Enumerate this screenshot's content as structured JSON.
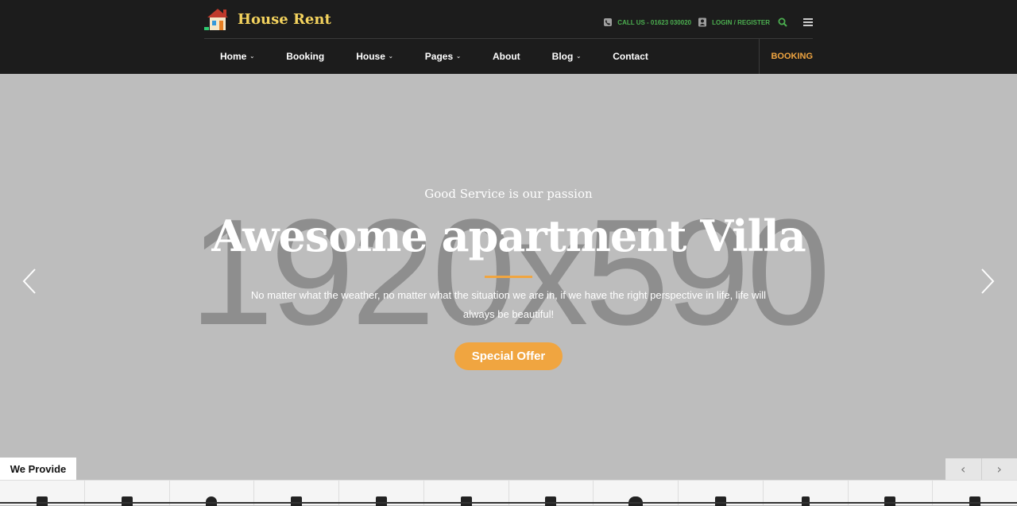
{
  "brand": {
    "name": "House Rent"
  },
  "topbar": {
    "call_label": "CALL US - 01623 030020",
    "login_label": "LOGIN / REGISTER"
  },
  "nav": {
    "items": [
      {
        "label": "Home",
        "has_dropdown": true
      },
      {
        "label": "Booking",
        "has_dropdown": false
      },
      {
        "label": "House",
        "has_dropdown": true
      },
      {
        "label": "Pages",
        "has_dropdown": true
      },
      {
        "label": "About",
        "has_dropdown": false
      },
      {
        "label": "Blog",
        "has_dropdown": true
      },
      {
        "label": "Contact",
        "has_dropdown": false
      }
    ],
    "booking_label": "BOOKING",
    "caret": "⌄"
  },
  "hero": {
    "placeholder": "1920x590",
    "kicker": "Good Service is our passion",
    "title": "Awesome apartment Villa",
    "description": "No matter what the weather, no matter what the situation we are in, if we have the right perspective in life, life will always be beautiful!",
    "cta_label": "Special Offer"
  },
  "provide": {
    "label": "We Provide",
    "prev": "‹",
    "next": "›"
  },
  "colors": {
    "accent": "#f0a540",
    "brand": "#f4d35e",
    "topinfo": "#4caf50",
    "header_bg": "#1c1c1c",
    "hero_bg": "#bdbdbd"
  }
}
